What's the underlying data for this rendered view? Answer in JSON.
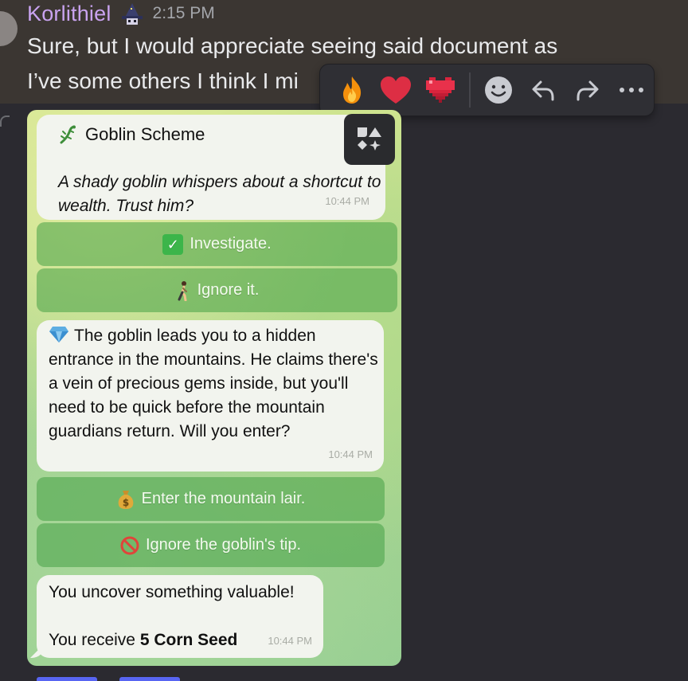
{
  "message": {
    "username": "Korlithiel",
    "timestamp": "2:15 PM",
    "text_line1": "Sure, but I would appreciate seeing said document as",
    "text_line2": "I’ve some others I think I mi"
  },
  "toolbar": {
    "reactions": [
      "fire-emoji",
      "red-heart-emoji",
      "pixel-heart-emoji"
    ],
    "actions": [
      "add-reaction-icon",
      "reply-icon",
      "forward-icon",
      "more-icon"
    ]
  },
  "telegram": {
    "card": {
      "title": "Goblin Scheme",
      "body": "A shady goblin whispers about a shortcut to wealth. Trust him?",
      "time": "10:44 PM"
    },
    "buttons1": [
      {
        "emoji": "✅",
        "label": "Investigate."
      },
      {
        "emoji": "🚶",
        "label": "Ignore it."
      }
    ],
    "message2": {
      "emoji": "💎",
      "body": "The goblin leads you to a hidden entrance in the mountains. He claims there's a vein of precious gems inside, but you'll need to be quick before the mountain guardians return. Will you enter?",
      "time": "10:44 PM"
    },
    "buttons2": [
      {
        "emoji": "💰",
        "label": "Enter the mountain lair."
      },
      {
        "emoji": "🚫",
        "label": "Ignore the goblin's tip."
      }
    ],
    "message3": {
      "line1": "You uncover something valuable!",
      "line2_prefix": "You receive ",
      "line2_bold": "5 Corn Seed",
      "time": "10:44 PM"
    }
  },
  "colors": {
    "username": "#c9a3f0",
    "background": "#2b2a30",
    "message_highlight": "#3b3632",
    "button_green": "#4aa04a"
  }
}
